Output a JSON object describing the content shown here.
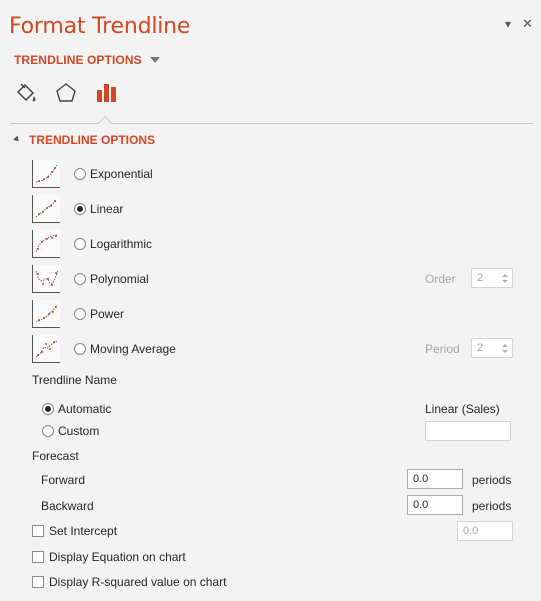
{
  "pane": {
    "title": "Format Trendline",
    "options_menu": "▾",
    "close": "✕"
  },
  "section_dropdown": "TRENDLINE OPTIONS",
  "tabs": [
    {
      "name": "fill-line",
      "icon": "paint-bucket-icon"
    },
    {
      "name": "effects",
      "icon": "pentagon-icon"
    },
    {
      "name": "trendline-options",
      "icon": "bar-chart-icon",
      "selected": true
    }
  ],
  "section_header": "TRENDLINE OPTIONS",
  "trend_types": [
    {
      "label": "Exponential",
      "selected": false,
      "icon": "exponential-trend-icon"
    },
    {
      "label": "Linear",
      "selected": true,
      "icon": "linear-trend-icon"
    },
    {
      "label": "Logarithmic",
      "selected": false,
      "icon": "logarithmic-trend-icon"
    },
    {
      "label": "Polynomial",
      "selected": false,
      "icon": "polynomial-trend-icon"
    },
    {
      "label": "Power",
      "selected": false,
      "icon": "power-trend-icon"
    },
    {
      "label": "Moving Average",
      "selected": false,
      "icon": "moving-average-trend-icon"
    }
  ],
  "order": {
    "label": "Order",
    "value": "2"
  },
  "period": {
    "label": "Period",
    "value": "2"
  },
  "trendline_name": {
    "heading": "Trendline Name",
    "automatic_label": "Automatic",
    "automatic_selected": true,
    "automatic_value": "Linear (Sales)",
    "custom_label": "Custom",
    "custom_value": ""
  },
  "forecast": {
    "heading": "Forecast",
    "forward_label": "Forward",
    "forward_value": "0.0",
    "backward_label": "Backward",
    "backward_value": "0.0",
    "unit": "periods"
  },
  "set_intercept": {
    "label": "Set Intercept",
    "checked": false,
    "value": "0.0"
  },
  "display_equation": {
    "label": "Display Equation on chart",
    "checked": false
  },
  "display_rsquared": {
    "label": "Display R-squared value on chart",
    "checked": false
  },
  "colors": {
    "accent": "#d24726",
    "chart_icon": "#d24726",
    "background": "#f3f3f3"
  }
}
